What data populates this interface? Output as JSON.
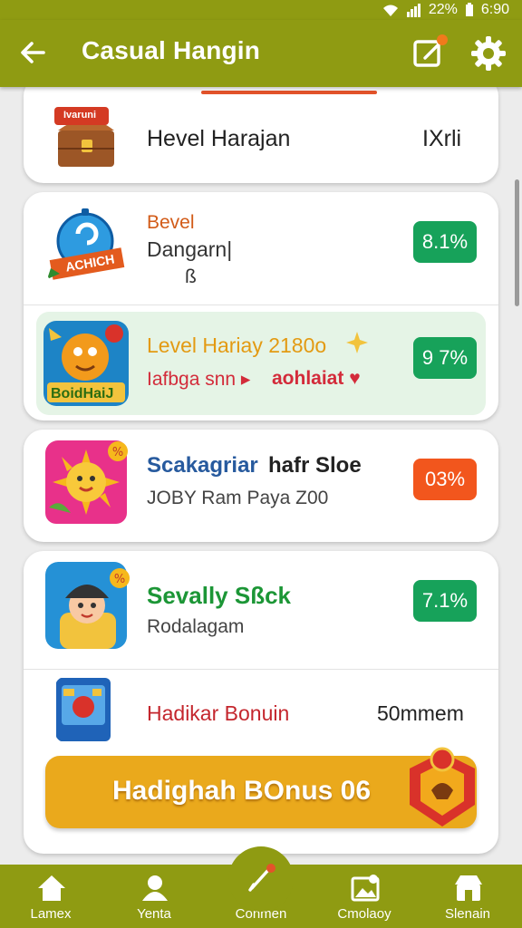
{
  "status": {
    "battery": "22%",
    "time": "6:90"
  },
  "header": {
    "title": "Casual Hangin"
  },
  "cards": {
    "first": {
      "title": "Hevel Harajan",
      "value": "IXrli",
      "chest_label": "Ivaruni"
    },
    "second": {
      "row1": {
        "line1": "Bevel",
        "line2": "Dangarn|",
        "line3": "ß",
        "badge": "8.1%",
        "icon_label": "ACHICH"
      },
      "row2": {
        "line1": "Level Hariay 2180o",
        "line2": "Iafbga snn ▸",
        "line2_b": "aohlaiat ♥",
        "badge": "9 7%",
        "icon_label": "BoidHaiJ"
      }
    },
    "third": {
      "title_a": "Scakagriar",
      "title_b": "hafr Sloe",
      "subtitle": "JOBY Ram Paya Z00",
      "badge": "03%"
    },
    "fourth": {
      "row1": {
        "title": "Sevally Sßck",
        "subtitle": "Rodalagam",
        "badge": "7.1%"
      },
      "row2": {
        "title": "Hadikar Bonuin",
        "value": "50mmem"
      },
      "bonus_button": "Hadighah BOnus 06"
    }
  },
  "nav": {
    "items": [
      {
        "label": "Lamex"
      },
      {
        "label": "Yenta"
      },
      {
        "label": "Conmen"
      },
      {
        "label": "Cmolaoy"
      },
      {
        "label": "Slenain"
      }
    ]
  },
  "colors": {
    "primary": "#8f9b12",
    "green_badge": "#17a25a",
    "orange_badge": "#f2561d",
    "bonus": "#eaa91c",
    "highlight": "#e5f4e6"
  }
}
